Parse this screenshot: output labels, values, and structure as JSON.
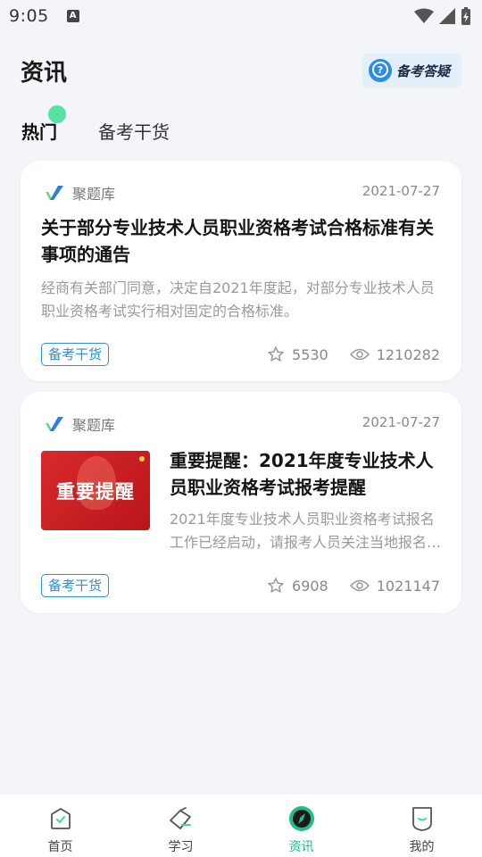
{
  "status_bar": {
    "time": "9:05",
    "notification_glyph": "A"
  },
  "header": {
    "title": "资讯",
    "qa_button": "备考答疑"
  },
  "tabs": [
    {
      "label": "热门",
      "active": true
    },
    {
      "label": "备考干货",
      "active": false
    }
  ],
  "articles": [
    {
      "source": "聚题库",
      "date": "2021-07-27",
      "title": "关于部分专业技术人员职业资格考试合格标准有关事项的通告",
      "description": "经商有关部门同意，决定自2021年度起，对部分专业技术人员职业资格考试实行相对固定的合格标准。",
      "tag": "备考干货",
      "favorites": "5530",
      "views": "1210282"
    },
    {
      "source": "聚题库",
      "date": "2021-07-27",
      "thumbnail_text": "重要提醒",
      "title": "重要提醒：2021年度专业技术人员职业资格考试报考提醒",
      "description": "2021年度专业技术人员职业资格考试报名工作已经启动，请报考人员关注当地报名通知。",
      "tag": "备考干货",
      "favorites": "6908",
      "views": "1021147"
    }
  ],
  "bottom_nav": [
    {
      "label": "首页",
      "icon": "home-icon"
    },
    {
      "label": "学习",
      "icon": "study-icon"
    },
    {
      "label": "资讯",
      "icon": "compass-icon",
      "active": true
    },
    {
      "label": "我的",
      "icon": "profile-icon"
    }
  ],
  "colors": {
    "accent": "#1fbf86",
    "tag_blue": "#2f8fd8",
    "background": "#f4f5f9"
  }
}
